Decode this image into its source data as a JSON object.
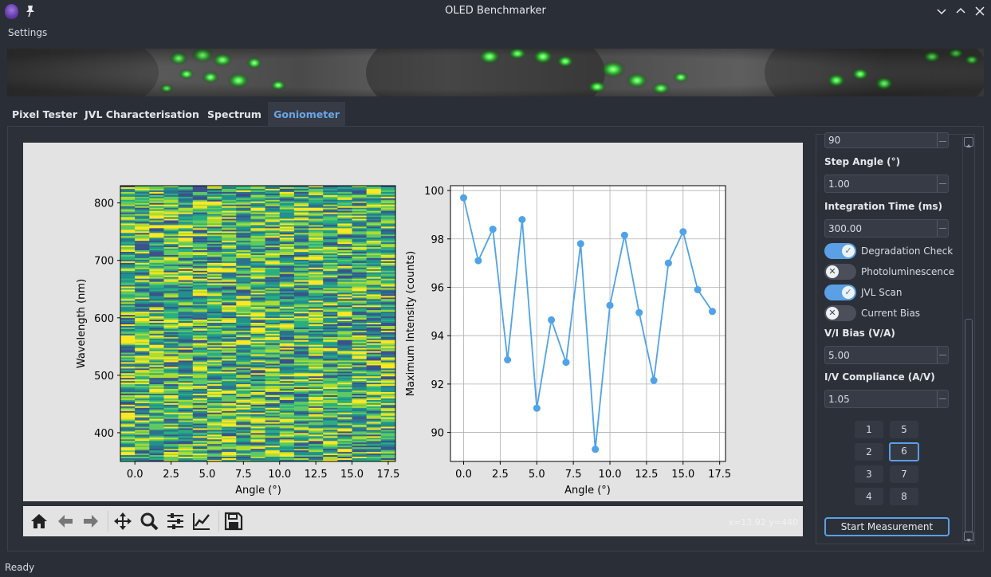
{
  "window": {
    "title": "OLED Benchmarker"
  },
  "menu": {
    "settings": "Settings"
  },
  "tabs": [
    "Pixel Tester",
    "JVL Characterisation",
    "Spectrum",
    "Goniometer"
  ],
  "active_tab": "Goniometer",
  "toolbar": {
    "coords": "x=13.92 y=440"
  },
  "sidebar": {
    "top_value": "90",
    "step_angle": {
      "label": "Step Angle (°)",
      "value": "1.00"
    },
    "integration_time": {
      "label": "Integration Time (ms)",
      "value": "300.00"
    },
    "toggles": [
      {
        "label": "Degradation Check",
        "on": true
      },
      {
        "label": "Photoluminescence",
        "on": false
      },
      {
        "label": "JVL Scan",
        "on": true
      },
      {
        "label": "Current Bias",
        "on": false
      }
    ],
    "vi_bias": {
      "label": "V/I Bias (V/A)",
      "value": "5.00"
    },
    "iv_compliance": {
      "label": "I/V Compliance (A/V)",
      "value": "1.05"
    },
    "pixels": [
      "1",
      "5",
      "2",
      "6",
      "3",
      "7",
      "4",
      "8"
    ],
    "selected_pixel": "6",
    "start_button": "Start Measurement"
  },
  "status": {
    "text": "Ready"
  },
  "colors": {
    "accent": "#5aa0e6",
    "line_color": "#4fa3e8"
  },
  "chart_data": [
    {
      "type": "heatmap",
      "xlabel": "Angle (°)",
      "ylabel": "Wavelength (nm)",
      "xticks": [
        "0.0",
        "2.5",
        "5.0",
        "7.5",
        "10.0",
        "12.5",
        "15.0",
        "17.5"
      ],
      "yticks": [
        "400",
        "500",
        "600",
        "700",
        "800"
      ],
      "xlim": [
        -1,
        18
      ],
      "ylim": [
        350,
        830
      ],
      "colormap": "viridis"
    },
    {
      "type": "line",
      "xlabel": "Angle (°)",
      "ylabel": "Maximum Intensity (counts)",
      "xticks": [
        "0.0",
        "2.5",
        "5.0",
        "7.5",
        "10.0",
        "12.5",
        "15.0",
        "17.5"
      ],
      "yticks": [
        "90",
        "92",
        "94",
        "96",
        "98",
        "100"
      ],
      "xlim": [
        -0.9,
        17.9
      ],
      "ylim": [
        88.8,
        100.2
      ],
      "grid": true,
      "x": [
        0,
        1,
        2,
        3,
        4,
        5,
        6,
        7,
        8,
        9,
        10,
        11,
        12,
        13,
        14,
        15,
        16,
        17
      ],
      "y": [
        99.7,
        97.1,
        98.4,
        93.0,
        98.8,
        91.0,
        94.65,
        92.9,
        97.8,
        89.3,
        95.25,
        98.15,
        94.95,
        92.15,
        97.0,
        98.3,
        95.9,
        95.0
      ]
    }
  ]
}
